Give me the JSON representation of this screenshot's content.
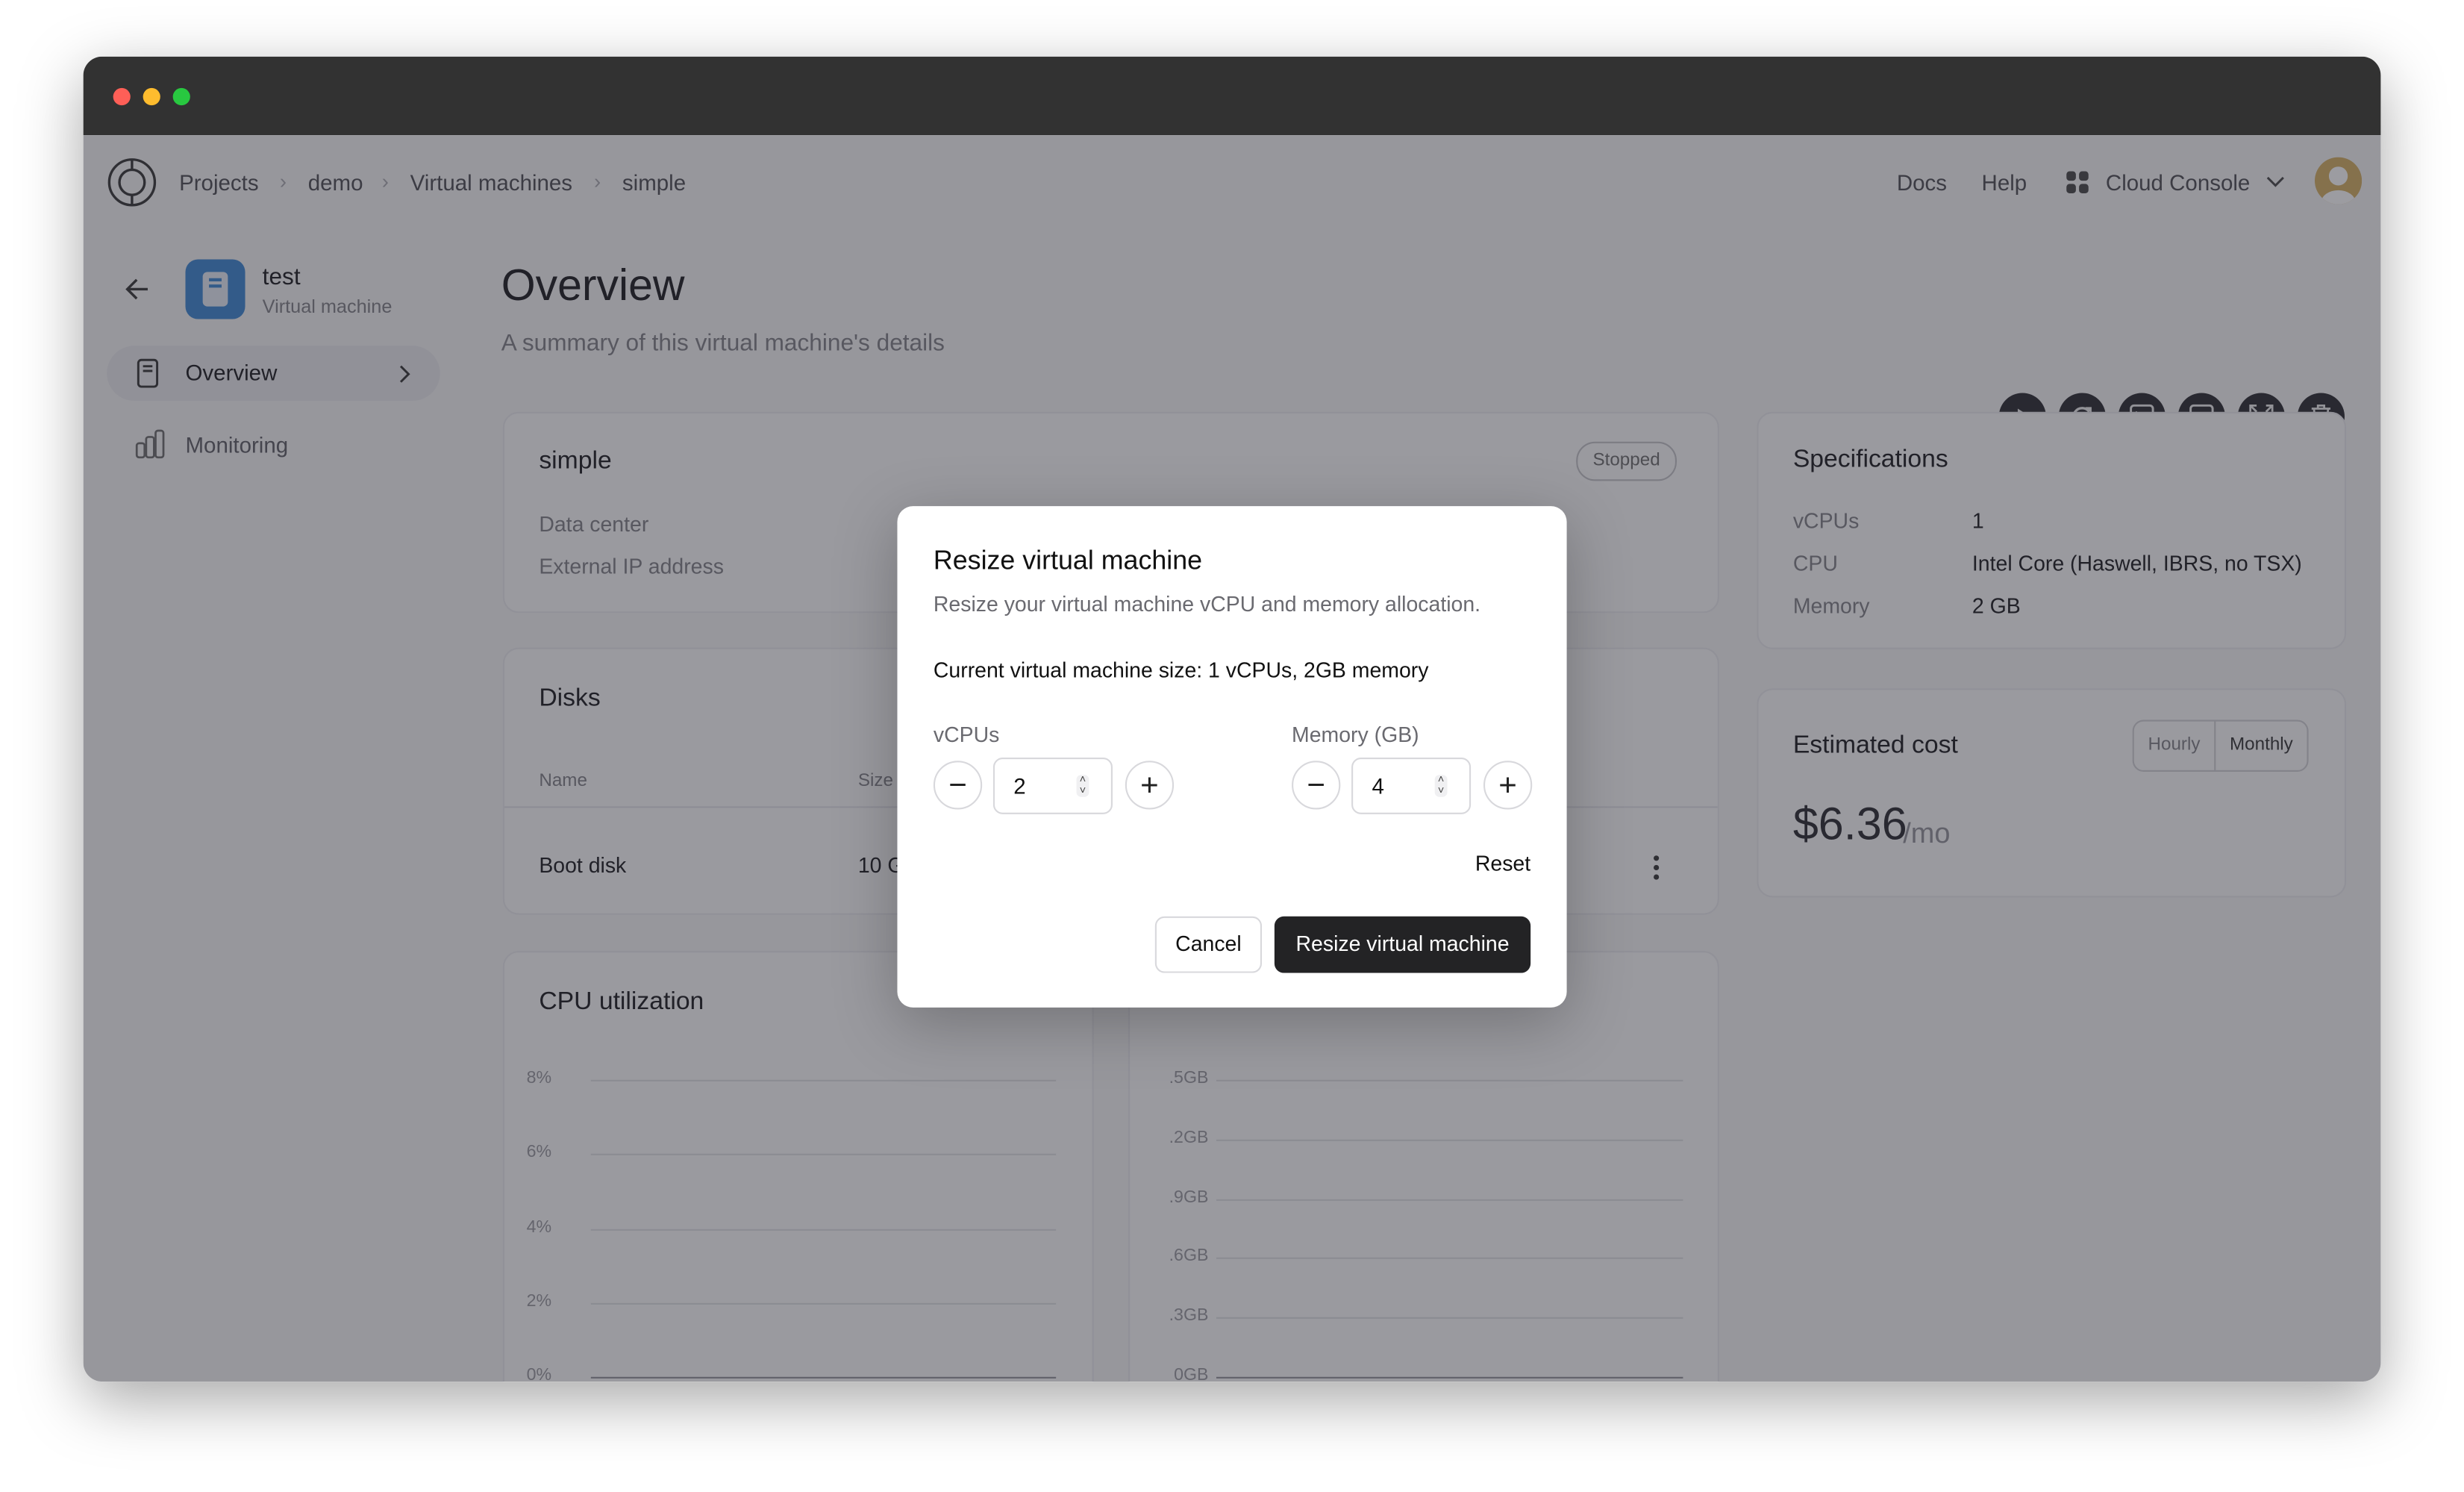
{
  "breadcrumbs": [
    "Projects",
    "demo",
    "Virtual machines",
    "simple"
  ],
  "header": {
    "docs": "Docs",
    "help": "Help",
    "console": "Cloud Console"
  },
  "sidebar": {
    "vm_name": "test",
    "vm_type": "Virtual machine",
    "items": [
      {
        "label": "Overview",
        "active": true
      },
      {
        "label": "Monitoring",
        "active": false
      }
    ]
  },
  "page": {
    "title": "Overview",
    "subtitle": "A summary of this virtual machine's details"
  },
  "actions": [
    "play-icon",
    "restart-icon",
    "terminal-icon",
    "console-display-icon",
    "resize-icon",
    "trash-icon"
  ],
  "summary": {
    "name": "simple",
    "status": "Stopped",
    "fields": [
      "Data center",
      "External IP address"
    ]
  },
  "disks": {
    "title": "Disks",
    "columns": [
      "Name",
      "Size"
    ],
    "rows": [
      {
        "name": "Boot disk",
        "size": "10 G"
      }
    ]
  },
  "cpu_chart": {
    "title": "CPU utilization",
    "ticks": [
      "8%",
      "6%",
      "4%",
      "2%",
      "0%"
    ]
  },
  "memory_chart": {
    "ticks": [
      ".5GB",
      ".2GB",
      ".9GB",
      ".6GB",
      ".3GB",
      "0GB"
    ]
  },
  "specs": {
    "title": "Specifications",
    "rows": [
      {
        "label": "vCPUs",
        "value": "1"
      },
      {
        "label": "CPU",
        "value": "Intel Core (Haswell, IBRS, no TSX)"
      },
      {
        "label": "Memory",
        "value": "2 GB"
      }
    ]
  },
  "cost": {
    "title": "Estimated cost",
    "toggle": [
      "Hourly",
      "Monthly"
    ],
    "selected": "Monthly",
    "amount": "$6.36",
    "unit": "/mo"
  },
  "modal": {
    "title": "Resize virtual machine",
    "description": "Resize your virtual machine vCPU and memory allocation.",
    "current": "Current virtual machine size: 1 vCPUs, 2GB memory",
    "vcpu_label": "vCPUs",
    "vcpu_value": "2",
    "memory_label": "Memory (GB)",
    "memory_value": "4",
    "reset": "Reset",
    "cancel": "Cancel",
    "submit": "Resize virtual machine"
  },
  "colors": {
    "titlebar": "#323232",
    "vm_icon": "#4a8fd6",
    "primary_button": "#232325",
    "avatar": "#d7b56d"
  }
}
